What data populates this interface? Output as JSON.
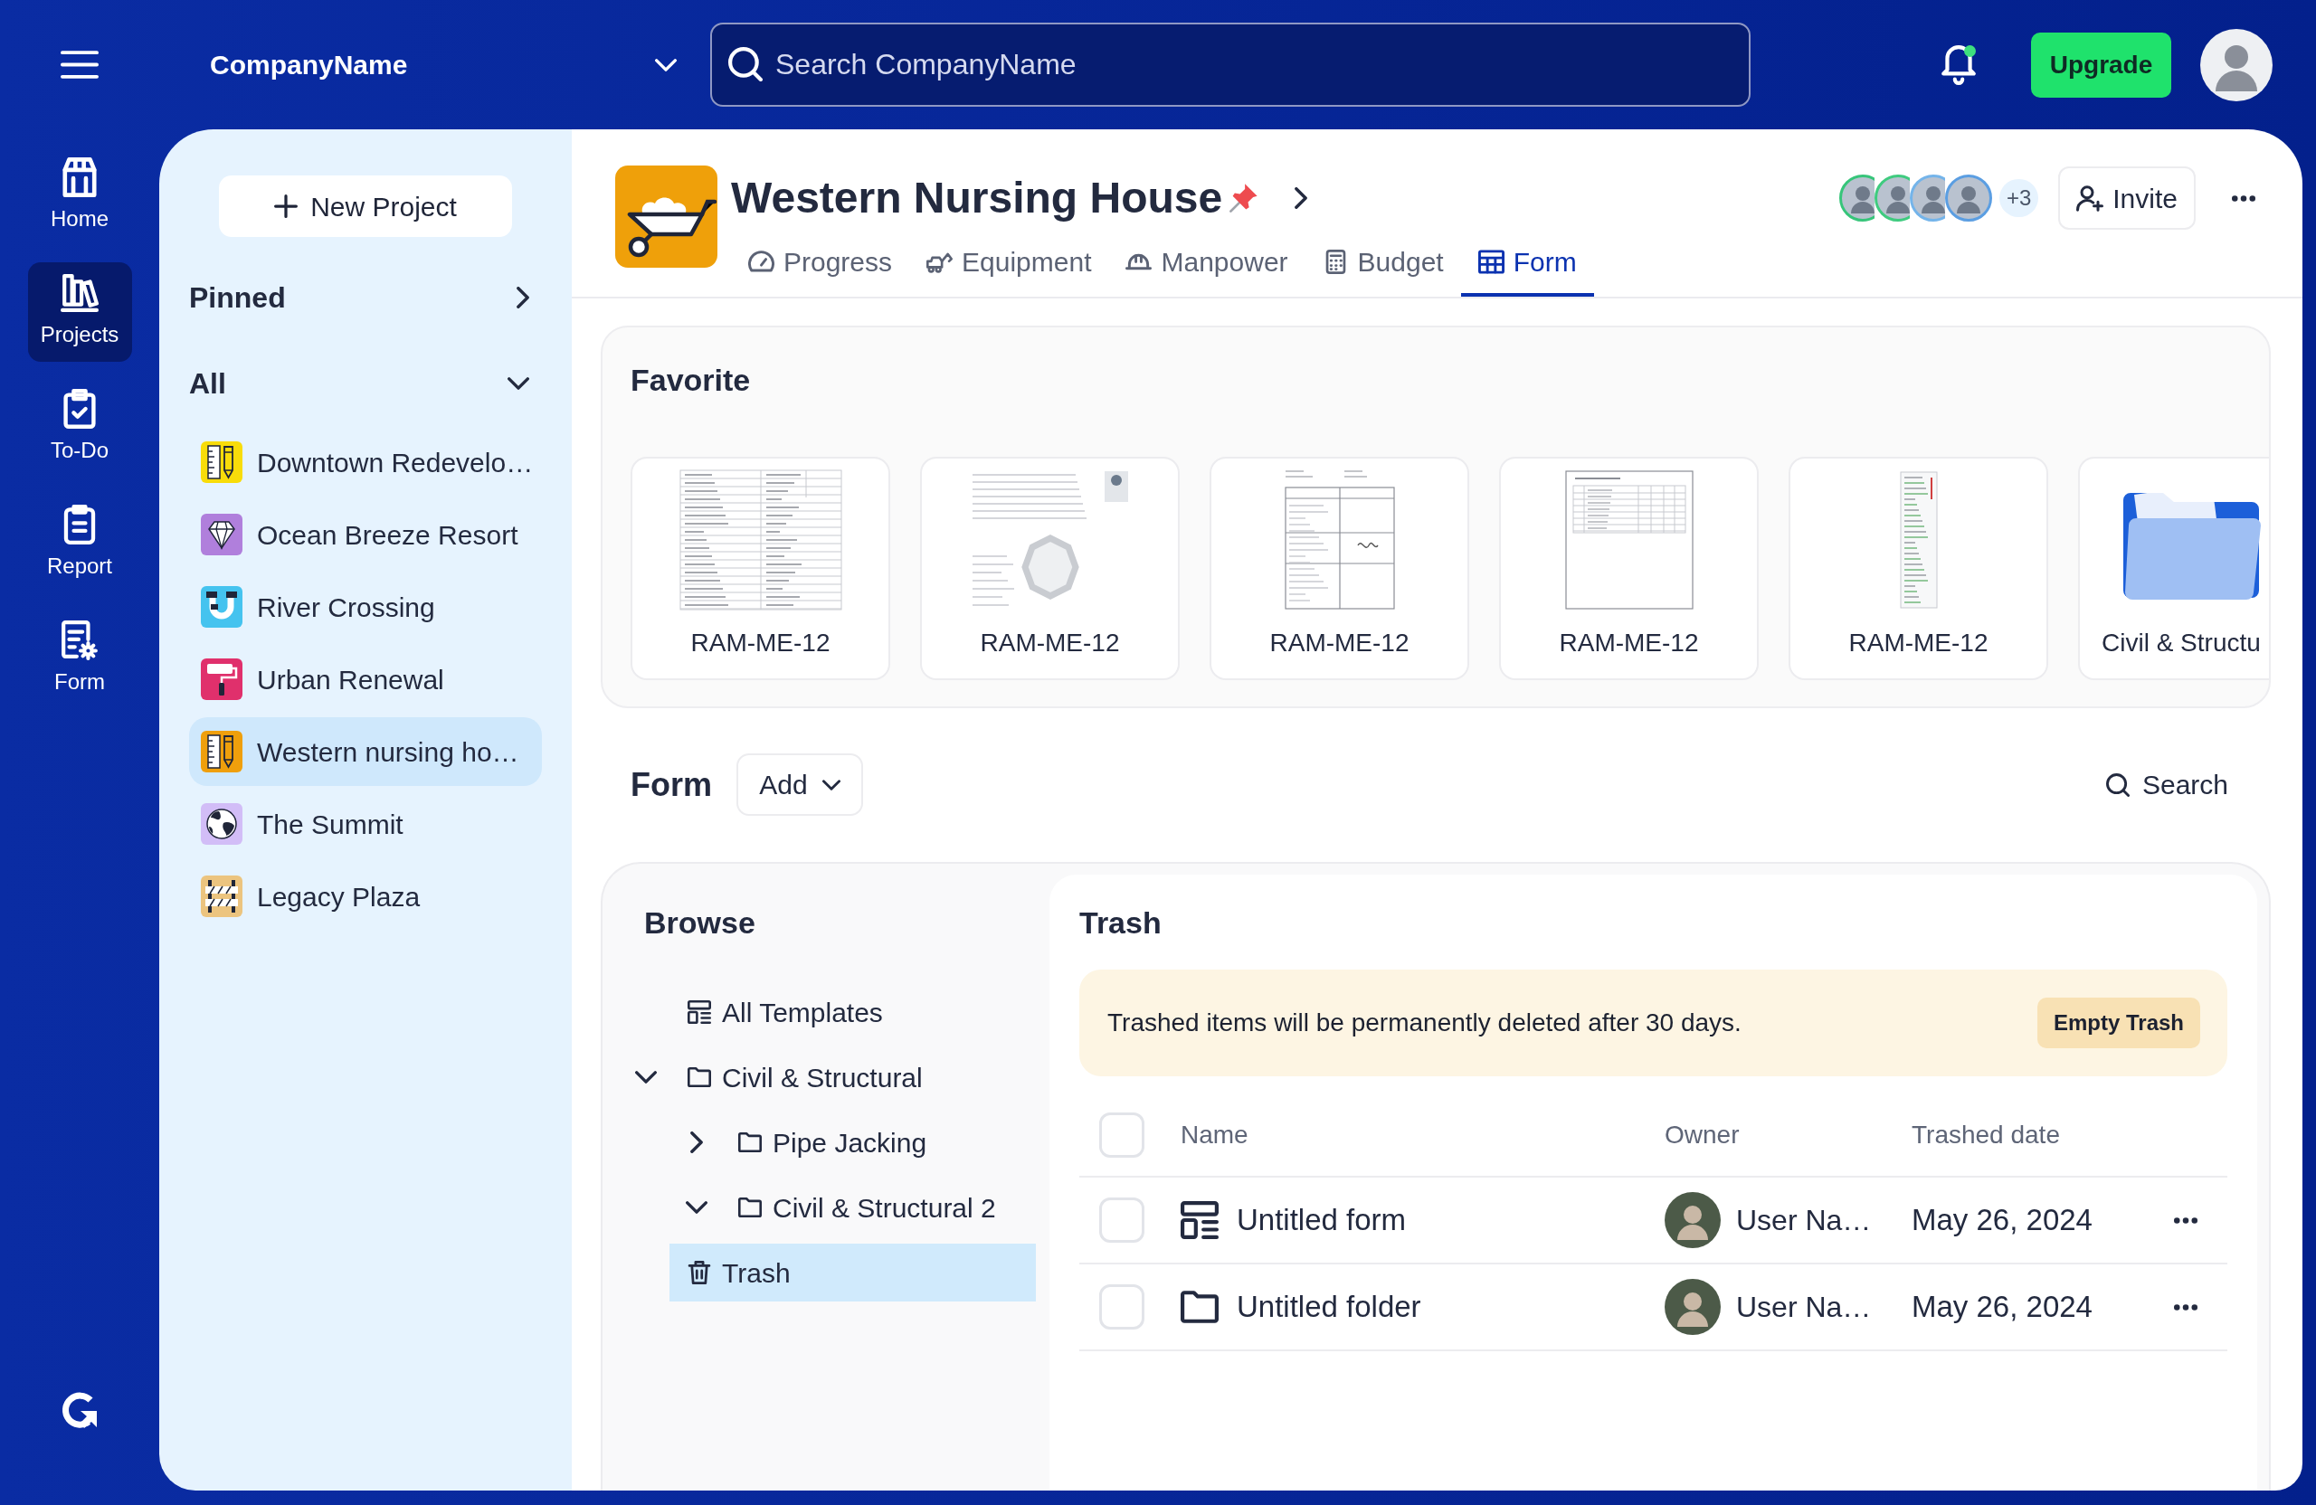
{
  "topbar": {
    "company": "CompanyName",
    "search": {
      "placeholder": "Search CompanyName"
    },
    "bell": {
      "unread": true
    },
    "upgrade": "Upgrade"
  },
  "nav": [
    {
      "label": "Home",
      "kind": "home",
      "selected": false
    },
    {
      "label": "Projects",
      "kind": "projects",
      "selected": true
    },
    {
      "label": "To-Do",
      "kind": "todo",
      "selected": false
    },
    {
      "label": "Report",
      "kind": "report",
      "selected": false
    },
    {
      "label": "Form",
      "kind": "form",
      "selected": false
    }
  ],
  "sidebar": {
    "new_project": "New Project",
    "sections": [
      {
        "label": "Pinned",
        "expanded": false
      },
      {
        "label": "All",
        "expanded": true,
        "projects": [
          {
            "name": "Downtown Redevelo…",
            "kind": "ruler",
            "color": "#f8dc0a",
            "selected": false
          },
          {
            "name": "Ocean Breeze Resort",
            "kind": "diamond",
            "color": "#b07fdc",
            "selected": false
          },
          {
            "name": "River Crossing",
            "kind": "pipe",
            "color": "#45c3ef",
            "selected": false
          },
          {
            "name": "Urban Renewal",
            "kind": "roller",
            "color": "#e0306c",
            "selected": false
          },
          {
            "name": "Western nursing ho…",
            "kind": "ruler",
            "color": "#ef9f0c",
            "selected": true
          },
          {
            "name": "The Summit",
            "kind": "globe",
            "color": "#d2bdf7",
            "selected": false
          },
          {
            "name": "Legacy Plaza",
            "kind": "barrier",
            "color": "#ecc47f",
            "selected": false
          }
        ]
      }
    ]
  },
  "project": {
    "title": "Western Nursing House",
    "pinned": true,
    "extra_members": "+3",
    "invite": "Invite",
    "tabs": [
      {
        "label": "Progress",
        "kind": "gauge",
        "selected": false
      },
      {
        "label": "Equipment",
        "kind": "excavator",
        "selected": false
      },
      {
        "label": "Manpower",
        "kind": "helmet",
        "selected": false
      },
      {
        "label": "Budget",
        "kind": "calculator",
        "selected": false
      },
      {
        "label": "Form",
        "kind": "table",
        "selected": true
      }
    ]
  },
  "favorite": {
    "title": "Favorite",
    "items": [
      {
        "label": "RAM-ME-12",
        "kind": "document"
      },
      {
        "label": "RAM-ME-12",
        "kind": "document"
      },
      {
        "label": "RAM-ME-12",
        "kind": "document"
      },
      {
        "label": "RAM-ME-12",
        "kind": "document"
      },
      {
        "label": "RAM-ME-12",
        "kind": "document"
      },
      {
        "label": "Civil & Structu",
        "kind": "folder"
      }
    ]
  },
  "form": {
    "title": "Form",
    "add": "Add",
    "search": "Search",
    "browse": {
      "title": "Browse",
      "tree": [
        {
          "label": "All Templates",
          "kind": "templates",
          "selected": false
        },
        {
          "label": "Civil & Structural",
          "kind": "folder",
          "expanded": true,
          "selected": false,
          "children": [
            {
              "label": "Pipe Jacking",
              "kind": "folder",
              "expanded": false,
              "selected": false
            },
            {
              "label": "Civil & Structural 2",
              "kind": "folder",
              "expanded": true,
              "selected": false
            }
          ]
        },
        {
          "label": "Trash",
          "kind": "trash",
          "selected": true
        }
      ]
    },
    "trash": {
      "title": "Trash",
      "notice": "Trashed items will be permanently deleted after 30 days.",
      "empty_button": "Empty Trash",
      "all_checked": false,
      "columns": [
        "Name",
        "Owner",
        "Trashed date"
      ],
      "rows": [
        {
          "kind": "form",
          "name": "Untitled form",
          "owner": "User Na…",
          "date": "May 26, 2024",
          "checked": false
        },
        {
          "kind": "folder",
          "name": "Untitled folder",
          "owner": "User Na…",
          "date": "May 26, 2024",
          "checked": false
        }
      ]
    }
  }
}
